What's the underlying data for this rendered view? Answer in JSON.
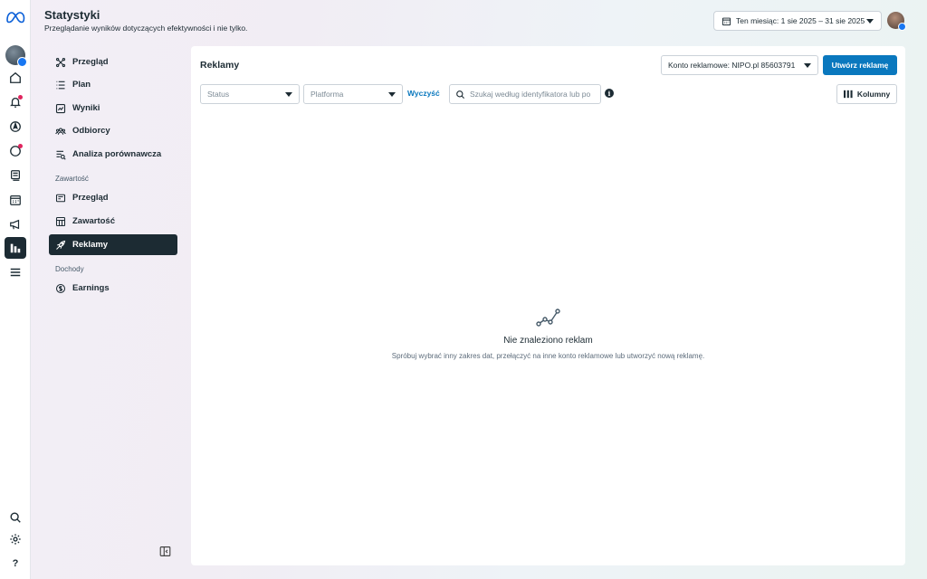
{
  "header": {
    "title": "Statystyki",
    "subtitle": "Przeglądanie wyników dotyczących efektywności i nie tylko.",
    "date_range": "Ten miesiąc: 1 sie 2025 – 31 sie 2025"
  },
  "rail": {
    "icons": [
      "meta-logo",
      "profile-avatar",
      "home-icon",
      "notifications-icon",
      "compass-icon",
      "messages-icon",
      "content-icon",
      "calendar-icon",
      "megaphone-icon",
      "insights-icon",
      "menu-icon",
      "search-icon",
      "settings-icon",
      "help-icon"
    ],
    "help_glyph": "?"
  },
  "nav": {
    "items": [
      {
        "label": "Przegląd",
        "icon": "overview-icon"
      },
      {
        "label": "Plan",
        "icon": "plan-icon"
      },
      {
        "label": "Wyniki",
        "icon": "results-icon"
      },
      {
        "label": "Odbiorcy",
        "icon": "audience-icon"
      },
      {
        "label": "Analiza porównawcza",
        "icon": "benchmark-icon"
      }
    ],
    "section_content": "Zawartość",
    "content_items": [
      {
        "label": "Przegląd",
        "icon": "content-overview-icon"
      },
      {
        "label": "Zawartość",
        "icon": "content-grid-icon"
      },
      {
        "label": "Reklamy",
        "icon": "ads-rocket-icon",
        "active": true
      }
    ],
    "section_income": "Dochody",
    "income_items": [
      {
        "label": "Earnings",
        "icon": "dollar-icon"
      }
    ]
  },
  "main": {
    "title": "Reklamy",
    "account_select": "Konto reklamowe: NIPO.pl 85603791",
    "create_button": "Utwórz reklamę",
    "filters": {
      "status_placeholder": "Status",
      "platform_placeholder": "Platforma",
      "clear_label": "Wyczyść",
      "search_placeholder": "Szukaj według identyfikatora lub po",
      "info_glyph": "i",
      "columns_label": "Kolumny"
    },
    "empty_state": {
      "title": "Nie znaleziono reklam",
      "description": "Spróbuj wybrać inny zakres dat, przełączyć na inne konto reklamowe lub utworzyć nową reklamę."
    }
  },
  "colors": {
    "primary": "#0a78be",
    "dark": "#1c2b33",
    "notification": "#e0245e"
  }
}
